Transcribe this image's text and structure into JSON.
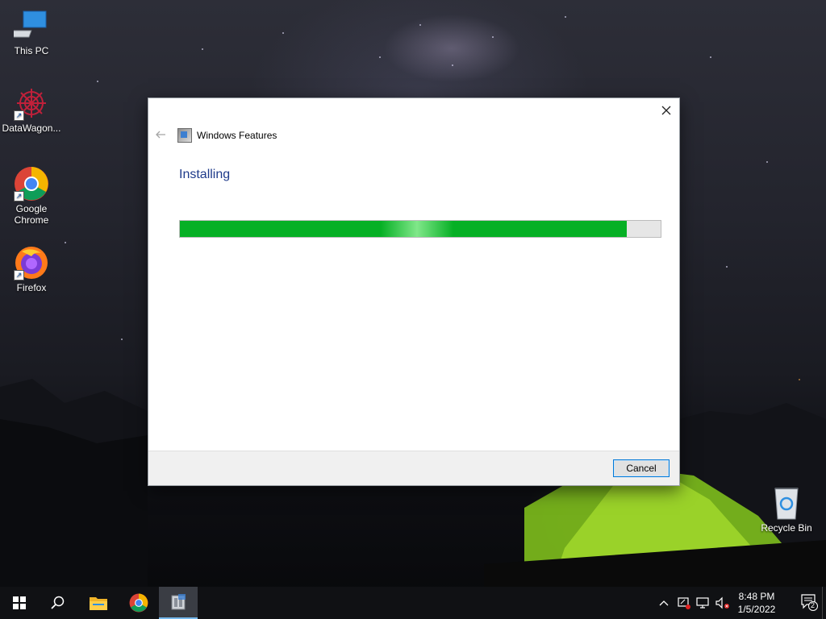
{
  "desktop": {
    "icons": [
      {
        "label": "This PC"
      },
      {
        "label": "DataWagon..."
      },
      {
        "label": "Google Chrome"
      },
      {
        "label": "Firefox"
      },
      {
        "label": "Recycle Bin"
      }
    ]
  },
  "dialog": {
    "title": "Windows Features",
    "heading": "Installing",
    "progress": 0.93,
    "cancel_label": "Cancel"
  },
  "taskbar": {
    "items": [
      "start-icon",
      "search-icon",
      "file-explorer-icon",
      "chrome-icon",
      "windows-features-icon"
    ],
    "active_item": "windows-features-icon",
    "tray_icons": [
      "chevron-up-icon",
      "network-icon",
      "display-icon",
      "speaker-muted-icon"
    ],
    "time": "8:48 PM",
    "date": "1/5/2022",
    "notification_count": "2"
  },
  "colors": {
    "progress": "#06b025",
    "heading": "#1e3a8a",
    "accent": "#0078d7",
    "taskbar": "#101114"
  }
}
